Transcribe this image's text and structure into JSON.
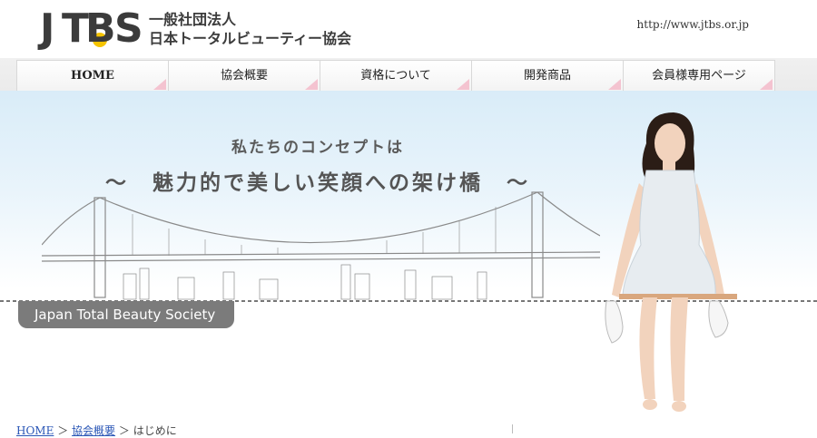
{
  "header": {
    "logo_mark": "JTBS",
    "org_line1": "一般社団法人",
    "org_line2": "日本トータルビューティー協会",
    "url": "http://www.jtbs.or.jp"
  },
  "nav": {
    "items": [
      {
        "label": "HOME"
      },
      {
        "label": "協会概要"
      },
      {
        "label": "資格について"
      },
      {
        "label": "開発商品"
      },
      {
        "label": "会員様専用ページ"
      }
    ]
  },
  "hero": {
    "line1": "私たちのコンセプトは",
    "line2": "～　魅力的で美しい笑顔への架け橋　～",
    "society_label": "Japan Total Beauty Society"
  },
  "breadcrumb": {
    "items": [
      "HOME",
      "協会概要",
      "はじめに"
    ],
    "separator": "＞"
  },
  "colors": {
    "accent_pink": "#f4c3d0",
    "logo_yellow": "#f5c400",
    "link_blue": "#2a56b6"
  }
}
